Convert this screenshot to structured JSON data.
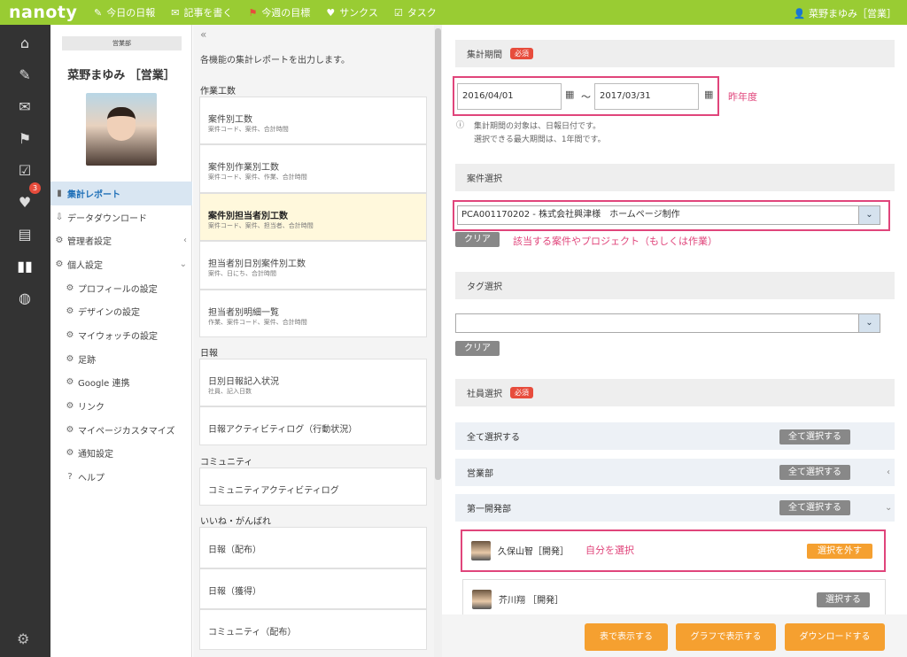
{
  "topbar": {
    "logo": "nanoty",
    "nav": [
      {
        "icon": "✎",
        "label": "今日の日報"
      },
      {
        "icon": "✉",
        "label": "記事を書く"
      },
      {
        "icon": "⚑",
        "label": "今週の目標"
      },
      {
        "icon": "♥",
        "label": "サンクス"
      },
      {
        "icon": "☑",
        "label": "タスク"
      }
    ],
    "user": "菜野まゆみ［営業］"
  },
  "rail": {
    "badge": "3"
  },
  "profile": {
    "department": "営業部",
    "name": "菜野まゆみ ［営業］",
    "menu": [
      {
        "icon": "▮",
        "label": "集計レポート",
        "active": true
      },
      {
        "icon": "⇩",
        "label": "データダウンロード"
      },
      {
        "icon": "⚙",
        "label": "管理者設定",
        "chevron": "‹"
      },
      {
        "icon": "⚙",
        "label": "個人設定",
        "chevron": "⌄"
      },
      {
        "icon": "⚙",
        "label": "プロフィールの設定",
        "sub": true
      },
      {
        "icon": "⚙",
        "label": "デザインの設定",
        "sub": true
      },
      {
        "icon": "⚙",
        "label": "マイウォッチの設定",
        "sub": true
      },
      {
        "icon": "⚙",
        "label": "足跡",
        "sub": true
      },
      {
        "icon": "⚙",
        "label": "Google 連携",
        "sub": true
      },
      {
        "icon": "⚙",
        "label": "リンク",
        "sub": true
      },
      {
        "icon": "⚙",
        "label": "マイページカスタマイズ",
        "sub": true
      },
      {
        "icon": "⚙",
        "label": "通知設定",
        "sub": true
      },
      {
        "icon": "?",
        "label": "ヘルプ",
        "sub": true
      }
    ]
  },
  "reports": {
    "collapse": "«",
    "description": "各機能の集計レポートを出力します。",
    "sections": {
      "s1": "作業工数",
      "s2": "日報",
      "s3": "コミュニティ",
      "s4": "いいね・がんばれ"
    },
    "cards": {
      "c1": {
        "title": "案件別工数",
        "sub": "案件コード、案件、合計時間"
      },
      "c2": {
        "title": "案件別作業別工数",
        "sub": "案件コード、案件、作業、合計時間"
      },
      "c3": {
        "title": "案件別担当者別工数",
        "sub": "案件コード、案件、担当者、合計時間"
      },
      "c4": {
        "title": "担当者別日別案件別工数",
        "sub": "案件、日にち、合計時間"
      },
      "c5": {
        "title": "担当者別明細一覧",
        "sub": "作業、案件コード、案件、合計時間"
      },
      "c6": {
        "title": "日別日報記入状況",
        "sub": "社員、記入日数"
      },
      "c7": {
        "title": "日報アクティビティログ（行動状況）"
      },
      "c8": {
        "title": "コミュニティアクティビティログ"
      },
      "c9": {
        "title": "日報（配布）"
      },
      "c10": {
        "title": "日報（獲得）"
      },
      "c11": {
        "title": "コミュニティ（配布）"
      }
    }
  },
  "form": {
    "period": {
      "header": "集計期間",
      "required": "必須",
      "from": "2016/04/01",
      "tilde": "〜",
      "to": "2017/03/31",
      "annotation": "昨年度",
      "note1": "集計期間の対象は、日報日付です。",
      "note2": "選択できる最大期間は、1年間です。"
    },
    "project": {
      "header": "案件選択",
      "value": "PCA001170202 - 株式会社興津様　ホームページ制作",
      "clear": "クリア",
      "annotation": "該当する案件やプロジェクト（もしくは作業）"
    },
    "tag": {
      "header": "タグ選択",
      "value": "",
      "clear": "クリア"
    },
    "staff": {
      "header": "社員選択",
      "required": "必須",
      "rows": {
        "all": {
          "label": "全て選択する",
          "button": "全て選択する"
        },
        "sales": {
          "label": "営業部",
          "button": "全て選択する"
        },
        "dev1": {
          "label": "第一開発部",
          "button": "全て選択する"
        }
      },
      "employees": {
        "e1": {
          "name": "久保山智［開発］",
          "button": "選択を外す",
          "annotation": "自分を選択"
        },
        "e2": {
          "name": "芥川翔 ［開発］",
          "button": "選択する"
        }
      }
    }
  },
  "footer": {
    "table": "表で表示する",
    "graph": "グラフで表示する",
    "download": "ダウンロードする"
  }
}
